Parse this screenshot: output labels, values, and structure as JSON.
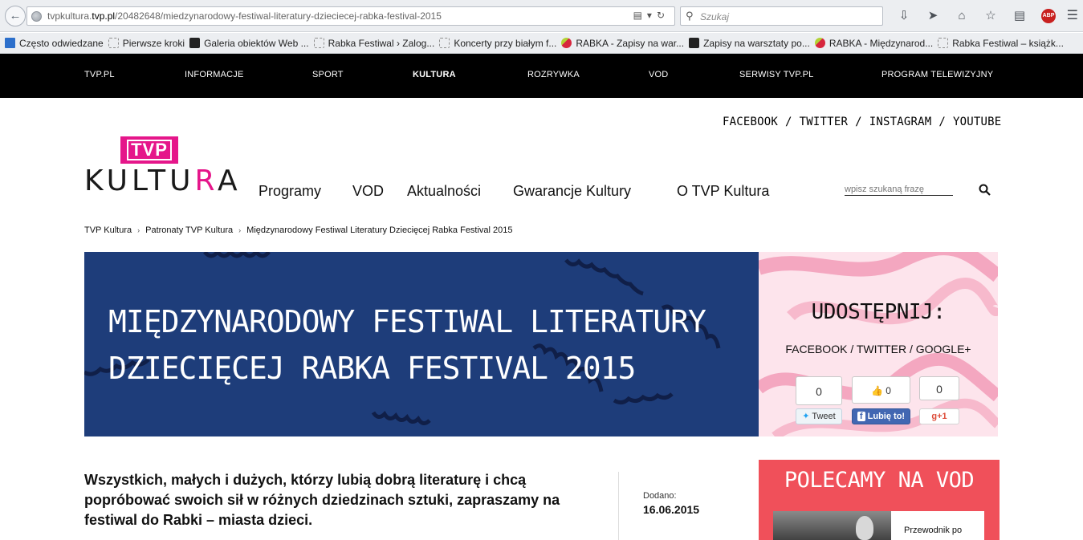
{
  "browser": {
    "url_domain": "tvpkultura.tvp.pl",
    "url_prefix": "tvpkultura.",
    "url_host": "tvp.pl",
    "url_path": "/20482648/miedzynarodowy-festiwal-literatury-dzieciecej-rabka-festival-2015",
    "search_placeholder": "Szukaj",
    "abp_label": "ABP"
  },
  "bookmarks": [
    "Często odwiedzane",
    "Pierwsze kroki",
    "Galeria obiektów Web ...",
    "Rabka Festiwal › Zalog...",
    "Koncerty przy białym f...",
    "RABKA - Zapisy na war...",
    "Zapisy na warsztaty po...",
    "RABKA - Międzynarod...",
    "Rabka Festiwal – książk..."
  ],
  "site_nav": [
    "TVP.PL",
    "INFORMACJE",
    "SPORT",
    "KULTURA",
    "ROZRYWKA",
    "VOD",
    "SERWISY TVP.PL",
    "PROGRAM TELEWIZYJNY"
  ],
  "social_top": [
    "FACEBOOK",
    "TWITTER",
    "INSTAGRAM",
    "YOUTUBE"
  ],
  "social_sep": "/",
  "logo": {
    "badge": "TVP",
    "word_main": "KULTU",
    "word_accent": "R",
    "word_end": "A"
  },
  "main_nav": [
    "Programy",
    "VOD",
    "Aktualności",
    "Gwarancje Kultury",
    "O TVP Kultura"
  ],
  "site_search_placeholder": "wpisz szukaną frazę",
  "breadcrumb": [
    "TVP Kultura",
    "Patronaty TVP Kultura",
    "Międzynarodowy Festiwal Literatury Dziecięcej Rabka Festival 2015"
  ],
  "breadcrumb_sep": "›",
  "hero": {
    "title": "MIĘDZYNARODOWY FESTIWAL LITERATURY DZIECIĘCEJ RABKA FESTIVAL 2015"
  },
  "share": {
    "title": "UDOSTĘPNIJ:",
    "links": "FACEBOOK / TWITTER / GOOGLE+",
    "tweet_count": "0",
    "tweet_label": "Tweet",
    "like_count": "0",
    "like_label": "Lubię to!",
    "gplus_count": "0",
    "gplus_label": "+1"
  },
  "article": {
    "lead": "Wszystkich, małych i dużych, którzy lubią dobrą literaturę i chcą popróbować swoich sił w różnych dziedzinach sztuki, zapraszamy na festiwal do Rabki – miasta dzieci.",
    "added_label": "Dodano:",
    "added_date": "16.06.2015"
  },
  "vod": {
    "title": "POLECAMY NA VOD",
    "caption": "Przewodnik po"
  },
  "colors": {
    "brand_pink": "#e5168a",
    "hero_blue": "#1e3d7a",
    "vod_red": "#f0505a",
    "nav_black": "#000000"
  }
}
